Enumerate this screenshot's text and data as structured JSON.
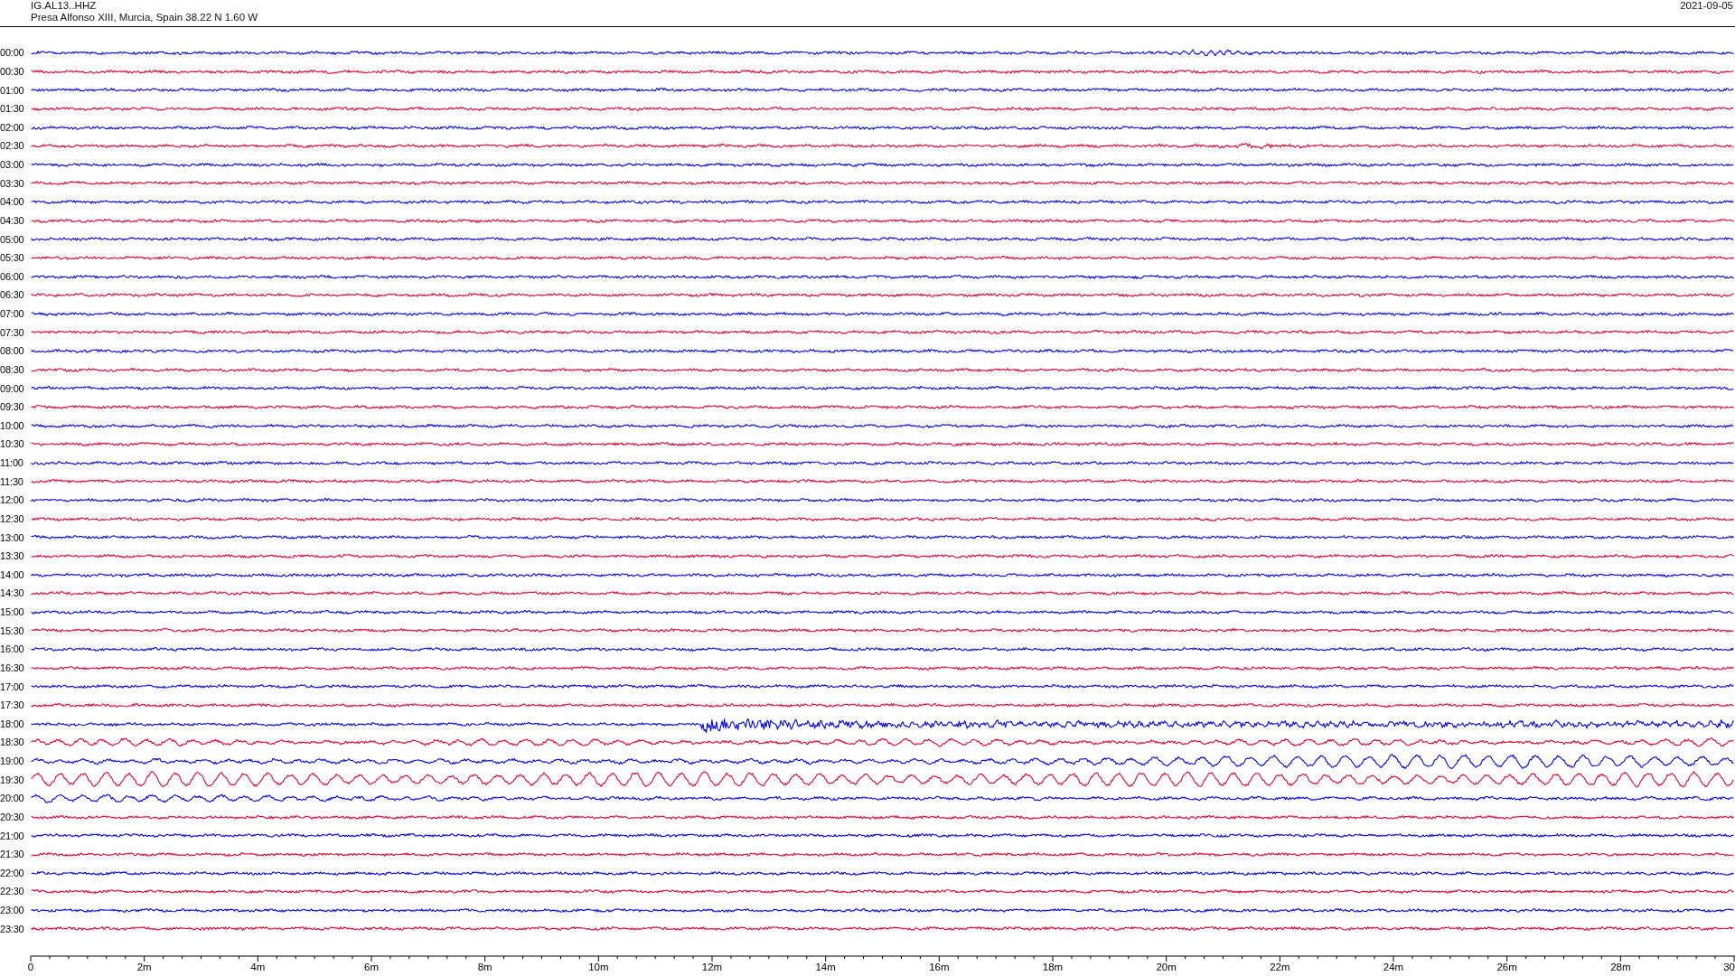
{
  "header": {
    "station": "IG.AL13..HHZ",
    "location": "Presa Alfonso XIII, Murcia, Spain  38.22 N 1.60 W",
    "date": "2021-09-05"
  },
  "traces": [
    {
      "label": "00:00",
      "color": "#0000f0"
    },
    {
      "label": "00:30",
      "color": "#e6002e"
    },
    {
      "label": "01:00",
      "color": "#0000f0"
    },
    {
      "label": "01:30",
      "color": "#e6002e"
    },
    {
      "label": "02:00",
      "color": "#0000f0"
    },
    {
      "label": "02:30",
      "color": "#e6002e"
    },
    {
      "label": "03:00",
      "color": "#0000f0"
    },
    {
      "label": "03:30",
      "color": "#e6002e"
    },
    {
      "label": "04:00",
      "color": "#0000f0"
    },
    {
      "label": "04:30",
      "color": "#e6002e"
    },
    {
      "label": "05:00",
      "color": "#0000f0"
    },
    {
      "label": "05:30",
      "color": "#e6002e"
    },
    {
      "label": "06:00",
      "color": "#0000f0"
    },
    {
      "label": "06:30",
      "color": "#e6002e"
    },
    {
      "label": "07:00",
      "color": "#0000f0"
    },
    {
      "label": "07:30",
      "color": "#e6002e"
    },
    {
      "label": "08:00",
      "color": "#0000f0"
    },
    {
      "label": "08:30",
      "color": "#e6002e"
    },
    {
      "label": "09:00",
      "color": "#0000f0"
    },
    {
      "label": "09:30",
      "color": "#e6002e"
    },
    {
      "label": "10:00",
      "color": "#0000f0"
    },
    {
      "label": "10:30",
      "color": "#e6002e"
    },
    {
      "label": "11:00",
      "color": "#0000f0"
    },
    {
      "label": "11:30",
      "color": "#e6002e"
    },
    {
      "label": "12:00",
      "color": "#0000f0"
    },
    {
      "label": "12:30",
      "color": "#e6002e"
    },
    {
      "label": "13:00",
      "color": "#0000f0"
    },
    {
      "label": "13:30",
      "color": "#e6002e"
    },
    {
      "label": "14:00",
      "color": "#0000f0"
    },
    {
      "label": "14:30",
      "color": "#e6002e"
    },
    {
      "label": "15:00",
      "color": "#0000f0"
    },
    {
      "label": "15:30",
      "color": "#e6002e"
    },
    {
      "label": "16:00",
      "color": "#0000f0"
    },
    {
      "label": "16:30",
      "color": "#e6002e"
    },
    {
      "label": "17:00",
      "color": "#0000f0"
    },
    {
      "label": "17:30",
      "color": "#e6002e"
    },
    {
      "label": "18:00",
      "color": "#0000f0"
    },
    {
      "label": "18:30",
      "color": "#e6002e"
    },
    {
      "label": "19:00",
      "color": "#0000f0"
    },
    {
      "label": "19:30",
      "color": "#e6002e"
    },
    {
      "label": "20:00",
      "color": "#0000f0"
    },
    {
      "label": "20:30",
      "color": "#e6002e"
    },
    {
      "label": "21:00",
      "color": "#0000f0"
    },
    {
      "label": "21:30",
      "color": "#e6002e"
    },
    {
      "label": "22:00",
      "color": "#0000f0"
    },
    {
      "label": "22:30",
      "color": "#e6002e"
    },
    {
      "label": "23:00",
      "color": "#0000f0"
    },
    {
      "label": "23:30",
      "color": "#e6002e"
    }
  ],
  "time_axis": {
    "tick_labels": [
      "0",
      "2m",
      "4m",
      "6m",
      "8m",
      "10m",
      "12m",
      "14m",
      "16m",
      "18m",
      "20m",
      "22m",
      "24m",
      "26m",
      "28m",
      "30"
    ]
  }
}
